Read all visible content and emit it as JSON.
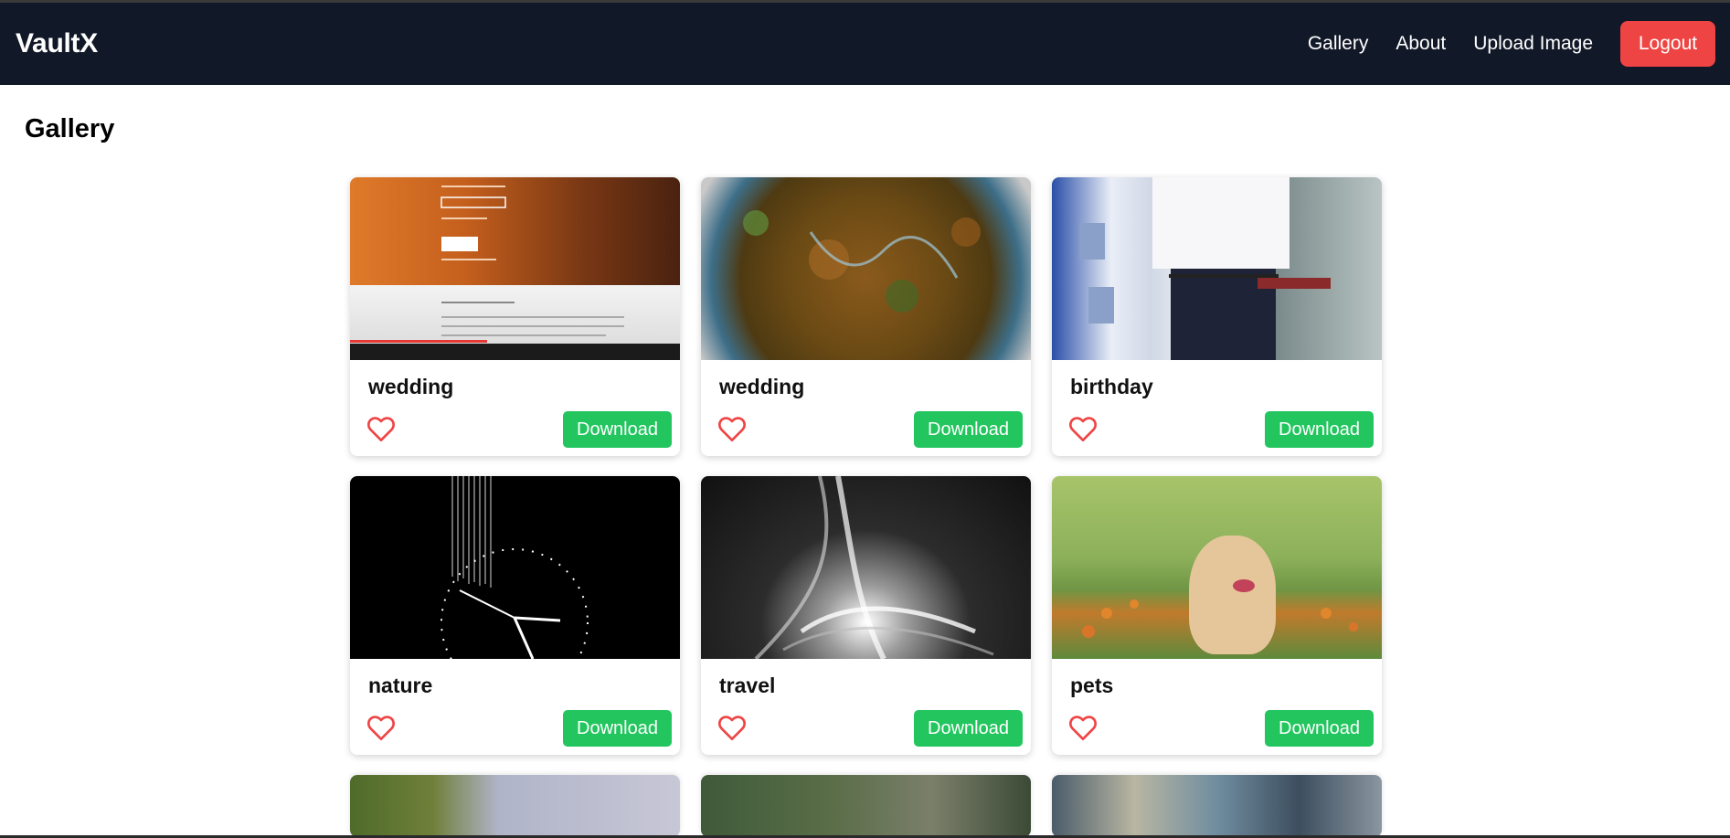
{
  "header": {
    "brand": "VaultX",
    "nav": [
      {
        "label": "Gallery"
      },
      {
        "label": "About"
      },
      {
        "label": "Upload Image"
      }
    ],
    "logout_label": "Logout"
  },
  "page": {
    "title": "Gallery"
  },
  "gallery": {
    "download_label": "Download",
    "cards": [
      {
        "title": "wedding",
        "image": "course-screenshot"
      },
      {
        "title": "wedding",
        "image": "food-plate"
      },
      {
        "title": "birthday",
        "image": "person-standing"
      },
      {
        "title": "nature",
        "image": "clock-lines"
      },
      {
        "title": "travel",
        "image": "light-swirl"
      },
      {
        "title": "pets",
        "image": "puppy-in-field"
      }
    ]
  },
  "colors": {
    "navbar_bg": "#111827",
    "logout_bg": "#ef4444",
    "download_bg": "#22c55e",
    "heart_stroke": "#ef4444"
  },
  "icons": {
    "like": "heart-outline-icon"
  }
}
